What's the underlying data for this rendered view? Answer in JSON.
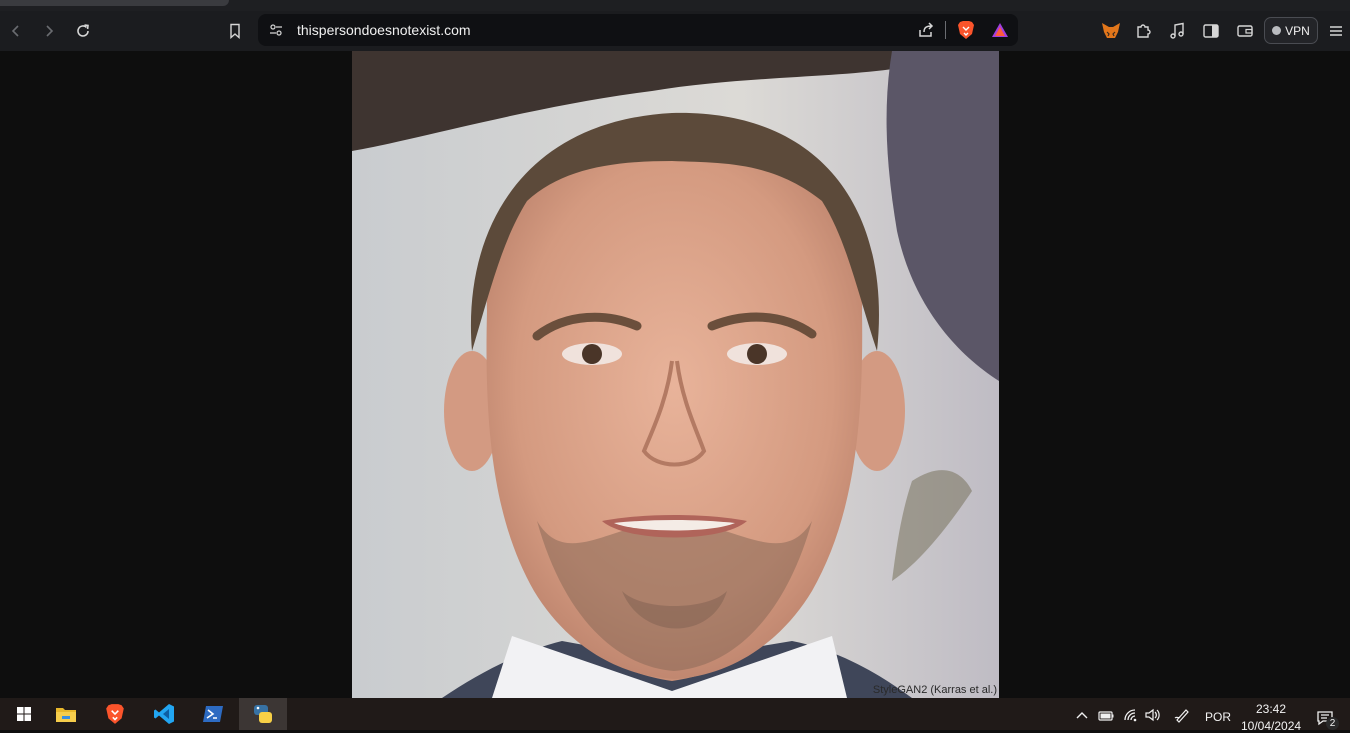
{
  "browser": {
    "url": "thispersondoesnotexist.com",
    "vpn_label": "VPN",
    "icons": {
      "back": "back-arrow-icon",
      "forward": "forward-arrow-icon",
      "reload": "reload-icon",
      "bookmark": "bookmark-icon",
      "site_info": "site-info-icon",
      "share": "share-icon",
      "brave_shields": "brave-lion-icon",
      "brave_rewards": "rewards-triangle-icon",
      "metamask": "fox-icon",
      "extensions": "puzzle-icon",
      "media": "music-note-icon",
      "sidebar": "sidebar-icon",
      "wallet": "wallet-icon",
      "menu": "hamburger-icon"
    }
  },
  "page": {
    "credit": "StyleGAN2 (Karras et al.)"
  },
  "taskbar": {
    "language": "POR",
    "time": "23:42",
    "date": "10/04/2024",
    "notification_count": "2",
    "apps": [
      "windows-start",
      "file-explorer",
      "brave-browser",
      "vscode",
      "powershell",
      "python"
    ]
  },
  "colors": {
    "toolbar_bg": "#1b1c1f",
    "urlbar_bg": "#0f1013",
    "page_bg": "#0e0e0e",
    "taskbar_bg": "#201a18",
    "brave_orange": "#fb542b",
    "vscode_blue": "#22a6f2"
  }
}
